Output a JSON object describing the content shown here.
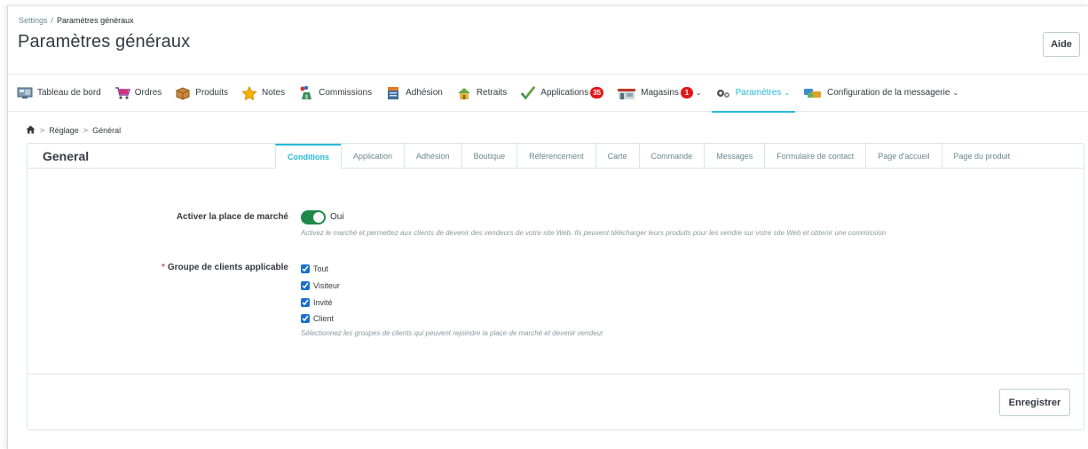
{
  "breadcrumb": {
    "root": "Settings",
    "separator": "/",
    "current": "Paramètres généraux"
  },
  "page_title": "Paramètres généraux",
  "help_button": "Aide",
  "nav": [
    {
      "label": "Tableau de bord",
      "icon": "dashboard-icon"
    },
    {
      "label": "Ordres",
      "icon": "cart-icon"
    },
    {
      "label": "Produits",
      "icon": "box-icon"
    },
    {
      "label": "Notes",
      "icon": "star-icon"
    },
    {
      "label": "Commissions",
      "icon": "money-bag-icon"
    },
    {
      "label": "Adhésion",
      "icon": "membership-icon"
    },
    {
      "label": "Retraits",
      "icon": "withdraw-icon"
    },
    {
      "label": "Applications",
      "icon": "check-icon",
      "badge": "35"
    },
    {
      "label": "Magasins",
      "icon": "store-icon",
      "badge": "1",
      "dropdown": true
    },
    {
      "label": "Paramètres",
      "icon": "gears-icon",
      "dropdown": true,
      "active": true
    },
    {
      "label": "Configuration de la messagerie",
      "icon": "messaging-icon",
      "dropdown": true
    }
  ],
  "sub_breadcrumb": {
    "home_icon": "home-icon",
    "items": [
      "Réglage",
      "Général"
    ],
    "separator": ">"
  },
  "panel": {
    "title": "General",
    "tabs": [
      "Conditions",
      "Application",
      "Adhésion",
      "Boutique",
      "Référencement",
      "Carte",
      "Commande",
      "Messages",
      "Formulaire de contact",
      "Page d'accueil",
      "Page du produit"
    ],
    "active_tab": "Conditions"
  },
  "form": {
    "marketplace": {
      "label": "Activer la place de marché",
      "toggle_on": true,
      "toggle_label": "Oui",
      "help": "Activez le marché et permettez aux clients de devenir des vendeurs de votre site Web. Ils peuvent télécharger leurs produits pour les vendre sur votre site Web et obtenir une commission"
    },
    "customer_groups": {
      "required_mark": "*",
      "label": "Groupe de clients applicable",
      "options": [
        {
          "label": "Tout",
          "checked": true
        },
        {
          "label": "Visiteur",
          "checked": true
        },
        {
          "label": "Invité",
          "checked": true
        },
        {
          "label": "Client",
          "checked": true
        }
      ],
      "help": "Sélectionnez les groupes de clients qui peuvent rejoindre la place de marché et devenir vendeur"
    }
  },
  "save_button": "Enregistrer",
  "colors": {
    "accent": "#25b9d7",
    "badge": "#e1171b",
    "toggle_on": "#1e8a4a",
    "checkbox": "#1a6fcf",
    "required": "#c05c67"
  }
}
